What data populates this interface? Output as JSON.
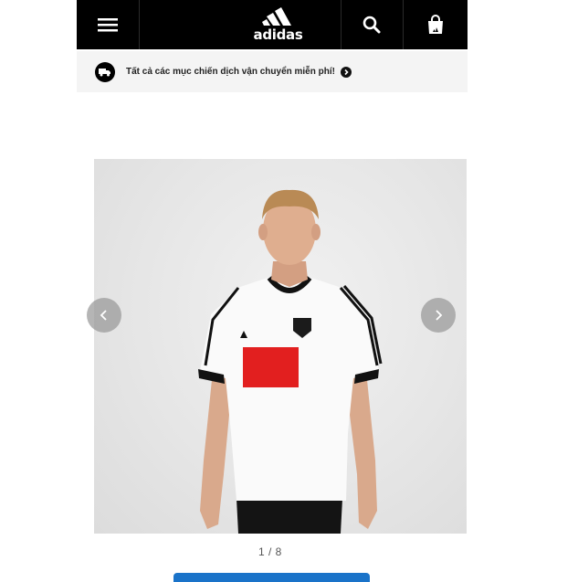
{
  "header": {
    "logo_text": "adidas",
    "menu_icon": "hamburger-menu-icon",
    "search_icon": "search-icon",
    "bag_icon": "shopping-bag-icon"
  },
  "shipping_banner": {
    "text": "Tất cả các mục chiến dịch vận chuyển miễn phí!",
    "icon": "delivery-truck-icon",
    "arrow_icon": "chevron-right-icon"
  },
  "gallery": {
    "counter": "1 / 8",
    "prev_icon": "chevron-left-icon",
    "next_icon": "chevron-right-icon",
    "colors": {
      "jersey_stripe": "#e21f1f",
      "accent_button": "#1a73c9"
    }
  }
}
